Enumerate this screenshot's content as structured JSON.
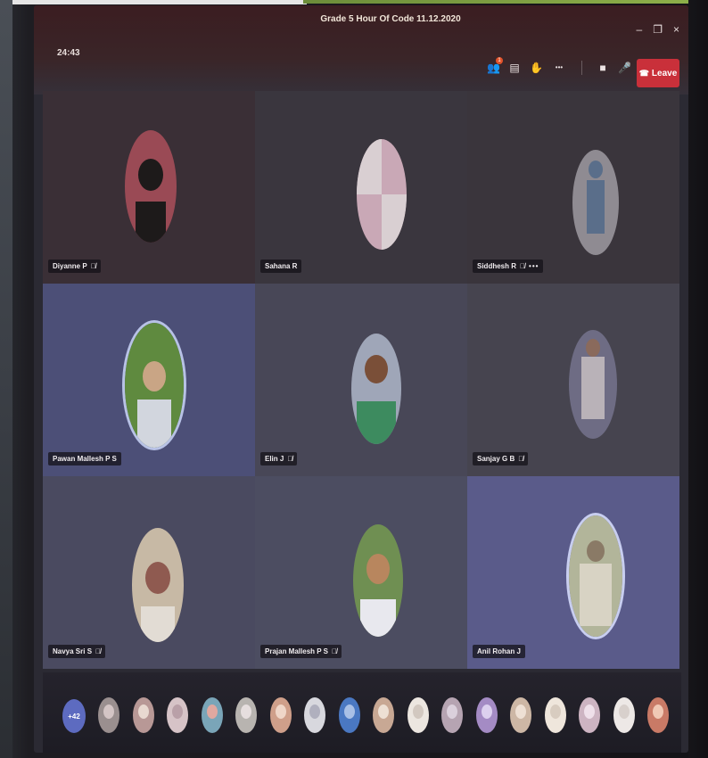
{
  "window": {
    "title": "Grade 5 Hour Of Code 11.12.2020",
    "minimize_glyph": "–",
    "restore_glyph": "❐",
    "close_glyph": "×"
  },
  "meeting": {
    "timer": "24:43"
  },
  "toolbar": {
    "items": [
      {
        "icon": "participants-icon",
        "glyph": "👥",
        "badge": "1"
      },
      {
        "icon": "chat-icon",
        "glyph": "▤"
      },
      {
        "icon": "raise-hand-icon",
        "glyph": "✋"
      },
      {
        "icon": "more-actions-icon",
        "glyph": "•••"
      },
      {
        "icon": "camera-off-icon",
        "glyph": "■"
      },
      {
        "icon": "mic-icon",
        "glyph": "🎤"
      },
      {
        "icon": "share-screen-icon",
        "glyph": "⧉"
      }
    ],
    "leave_label": "Leave",
    "leave_glyph": "☎"
  },
  "participants": [
    {
      "name": "Diyanne P",
      "muted": true,
      "more": false,
      "tile_color": "#3a2f36",
      "avatar_bg": "#9a4a55",
      "avatar_fg": "#1d1a1a"
    },
    {
      "name": "Sahana R",
      "muted": false,
      "more": false,
      "tile_color": "#3a363e",
      "avatar_bg": "#c9a8b6",
      "avatar_fg": "#d9cfd2"
    },
    {
      "name": "Siddhesh R",
      "muted": true,
      "more": true,
      "tile_color": "#3a353c",
      "avatar_bg": "#8f8b92",
      "avatar_fg": "#5a6e8a"
    },
    {
      "name": "Pawan Mallesh P S",
      "muted": false,
      "more": false,
      "tile_color": "#4c4f77",
      "avatar_bg": "#5f8a3f",
      "avatar_fg": "#c9a585"
    },
    {
      "name": "Elin J",
      "muted": true,
      "more": false,
      "tile_color": "#484757",
      "avatar_bg": "#9fa6b8",
      "avatar_fg": "#3d8b5f"
    },
    {
      "name": "Sanjay G B",
      "muted": true,
      "more": false,
      "tile_color": "#46444f",
      "avatar_bg": "#6e6c84",
      "avatar_fg": "#b9b2b8"
    },
    {
      "name": "Navya Sri S",
      "muted": true,
      "more": false,
      "tile_color": "#4a4a60",
      "avatar_bg": "#c7b9a5",
      "avatar_fg": "#8f5a50"
    },
    {
      "name": "Prajan Mallesh P S",
      "muted": true,
      "more": false,
      "tile_color": "#4c4d61",
      "avatar_bg": "#6f8f52",
      "avatar_fg": "#b8865e"
    },
    {
      "name": "Anil Rohan J",
      "muted": false,
      "more": false,
      "tile_color": "#5a5b8a",
      "avatar_bg": "#b2b59a",
      "avatar_fg": "#d8d3c4"
    }
  ],
  "strip": {
    "overflow_count": "+42",
    "thumbs": [
      {
        "bg": "#9a8f8f",
        "fg": "#d4c5c5"
      },
      {
        "bg": "#b89896",
        "fg": "#e8d8d0"
      },
      {
        "bg": "#d6c3c7",
        "fg": "#b9a0a8"
      },
      {
        "bg": "#7aa5b8",
        "fg": "#e0a8a0"
      },
      {
        "bg": "#b8b4b0",
        "fg": "#e6dede"
      },
      {
        "bg": "#cf9f8a",
        "fg": "#efd6c8"
      },
      {
        "bg": "#d8d8de",
        "fg": "#b0b0be"
      },
      {
        "bg": "#4a78c2",
        "fg": "#a9c0e6"
      },
      {
        "bg": "#c8a894",
        "fg": "#ede0d4"
      },
      {
        "bg": "#ece6e0",
        "fg": "#d2c8c0"
      },
      {
        "bg": "#b6a4b2",
        "fg": "#dbd0dc"
      },
      {
        "bg": "#a48bc4",
        "fg": "#dcd0ee"
      },
      {
        "bg": "#cdb7a5",
        "fg": "#eee0d4"
      },
      {
        "bg": "#efe6dc",
        "fg": "#d8ccc0"
      },
      {
        "bg": "#cdb4c2",
        "fg": "#efe0ea"
      },
      {
        "bg": "#ede8e6",
        "fg": "#d8d0cc"
      },
      {
        "bg": "#c97a66",
        "fg": "#f0c8b4"
      }
    ]
  }
}
